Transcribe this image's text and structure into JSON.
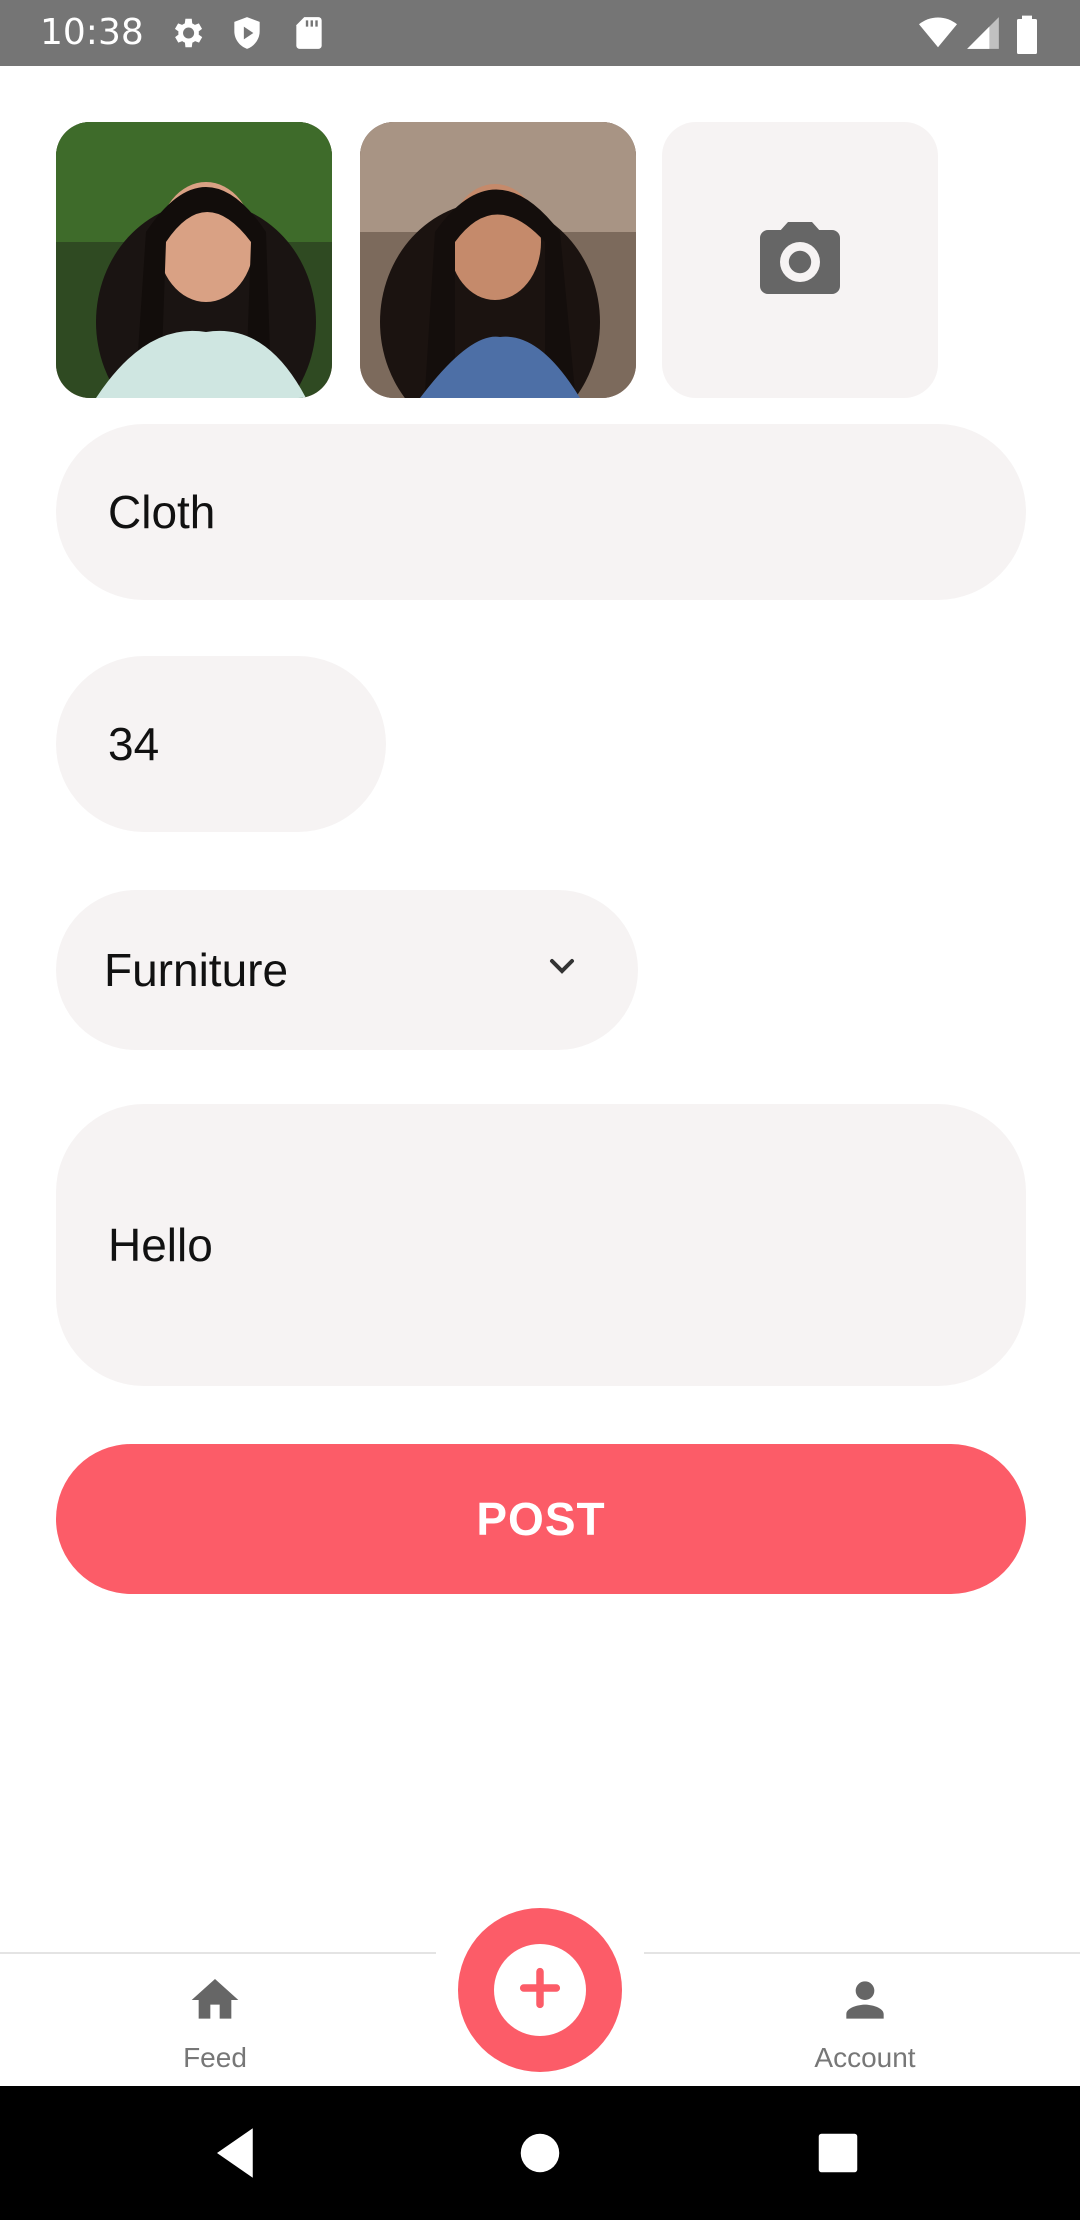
{
  "status_bar": {
    "time": "10:38",
    "left_icons": [
      "gear-icon",
      "shield-icon",
      "sd-card-icon"
    ],
    "right_icons": [
      "wifi-icon",
      "signal-icon",
      "battery-icon"
    ]
  },
  "photos": [
    {
      "name": "uploaded-photo-1"
    },
    {
      "name": "uploaded-photo-2"
    }
  ],
  "add_photo": {
    "icon": "camera-icon"
  },
  "form": {
    "title_value": "Cloth",
    "price_value": "34",
    "category_value": "Furniture",
    "description_value": "Hello"
  },
  "post_button": {
    "label": "POST"
  },
  "bottom_tabs": [
    {
      "label": "Feed",
      "icon": "home-icon"
    },
    {
      "label": "Account",
      "icon": "account-icon"
    }
  ],
  "fab": {
    "icon": "plus-icon"
  },
  "colors": {
    "accent": "#fc5c68",
    "field_bg": "#f6f3f3",
    "icon_gray": "#666666"
  }
}
